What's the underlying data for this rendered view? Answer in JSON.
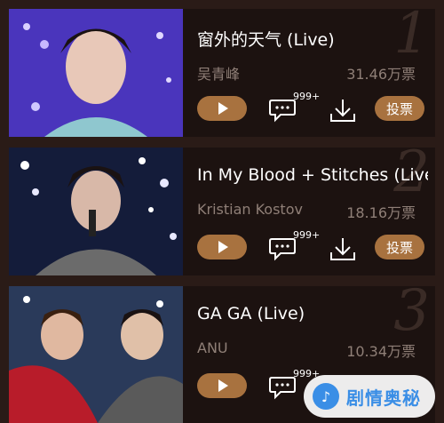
{
  "items": [
    {
      "rank": "1",
      "title": "窗外的天气 (Live)",
      "artist": "吴青峰",
      "votes": "31.46万票",
      "comment_count": "999+",
      "vote_label": "投票"
    },
    {
      "rank": "2",
      "title": "In My Blood + Stitches (Live)",
      "artist": "Kristian Kostov",
      "votes": "18.16万票",
      "comment_count": "999+",
      "vote_label": "投票"
    },
    {
      "rank": "3",
      "title": "GA GA (Live)",
      "artist": "ANU",
      "votes": "10.34万票",
      "comment_count": "999+",
      "vote_label": ""
    }
  ],
  "watermark": {
    "text": "剧情奥秘"
  },
  "colors": {
    "background": "#2a1b17",
    "card": "#1c1210",
    "accent": "#a8723f",
    "muted_text": "#8f7f77"
  }
}
